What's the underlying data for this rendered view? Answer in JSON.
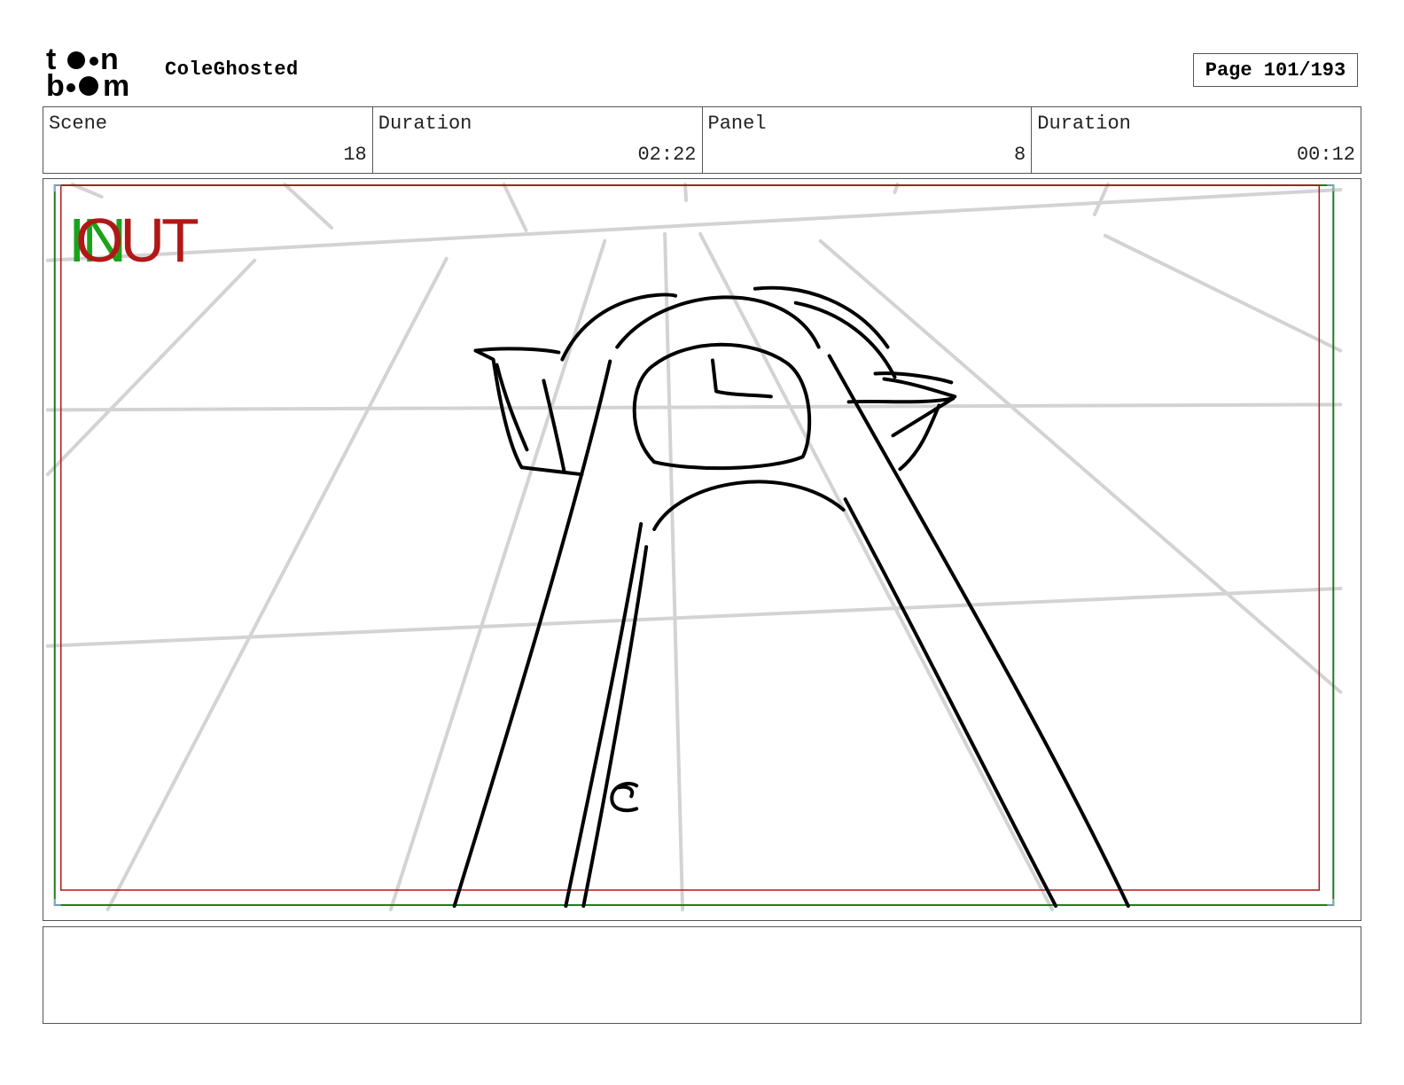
{
  "header": {
    "logo_top": "toon",
    "logo_bottom": "boom",
    "project_title": "ColeGhosted",
    "page_label": "Page 101/193"
  },
  "info": {
    "scene_label": "Scene",
    "scene_value": "18",
    "scene_duration_label": "Duration",
    "scene_duration_value": "02:22",
    "panel_label": "Panel",
    "panel_value": "8",
    "panel_duration_label": "Duration",
    "panel_duration_value": "00:12"
  },
  "panel": {
    "marker_in": "IN",
    "marker_out": "OUT",
    "colors": {
      "safe_area": "#b01818",
      "camera_frame": "#1f7a1f",
      "guide_lines": "#d3d3d3",
      "ink": "#000000"
    }
  },
  "caption": {
    "text": ""
  }
}
